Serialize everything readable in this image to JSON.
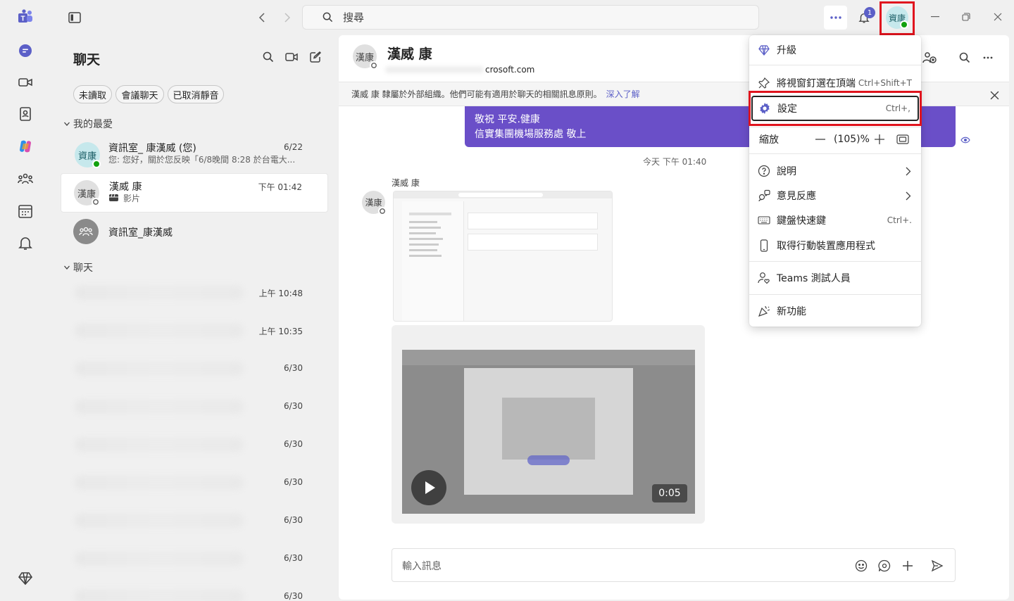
{
  "titlebar": {
    "search_placeholder": "搜尋",
    "notification_count": "1",
    "account_initials": "資康"
  },
  "chat_list": {
    "title": "聊天",
    "filters": [
      "未讀取",
      "會議聊天",
      "已取消靜音"
    ],
    "favorites_label": "我的最愛",
    "chats_label": "聊天",
    "favorites": [
      {
        "avatar": "資康",
        "name": "資訊室_ 康漢威 (您)",
        "date": "6/22",
        "preview": "您: 您好，關於您反映「6/8晚間 8:28 於台電大..."
      },
      {
        "avatar": "漢康",
        "name": "漢威 康",
        "date": "下午 01:42",
        "preview": "影片"
      },
      {
        "avatar": "",
        "name": "資訊室_康漢威",
        "date": "",
        "preview": ""
      }
    ],
    "chat_dates": [
      "上午 10:48",
      "上午 10:35",
      "6/30",
      "6/30",
      "6/30",
      "6/30",
      "6/30",
      "6/30",
      "6/30"
    ]
  },
  "conversation": {
    "avatar": "漢康",
    "name": "漢威 康",
    "email": "crosoft.com",
    "banner_text": "漢威 康 隸屬於外部組織。他們可能有適用於聊天的相關訊息原則。",
    "banner_link": "深入了解",
    "message_line1": "敬祝 平安.健康",
    "message_line2": "信實集團機場服務處 敬上",
    "timestamp": "今天 下午 01:40",
    "sender": "漢威 康",
    "video_duration": "0:05",
    "compose_placeholder": "輸入訊息"
  },
  "menu": {
    "upgrade": "升級",
    "pin": "將視窗釘選在頂端",
    "pin_shortcut": "Ctrl+Shift+T",
    "settings": "設定",
    "settings_shortcut": "Ctrl+,",
    "zoom_label": "縮放",
    "zoom_value": "(105)%",
    "help": "說明",
    "feedback": "意見反應",
    "shortcuts": "鍵盤快速鍵",
    "shortcuts_shortcut": "Ctrl+.",
    "mobile": "取得行動裝置應用程式",
    "tester": "Teams 測試人員",
    "whats_new": "新功能"
  },
  "colors": {
    "accent": "#5b5fc7",
    "message_bubble": "#6a4fc8",
    "highlight": "#e0141e",
    "presence_available": "#13a10e"
  }
}
